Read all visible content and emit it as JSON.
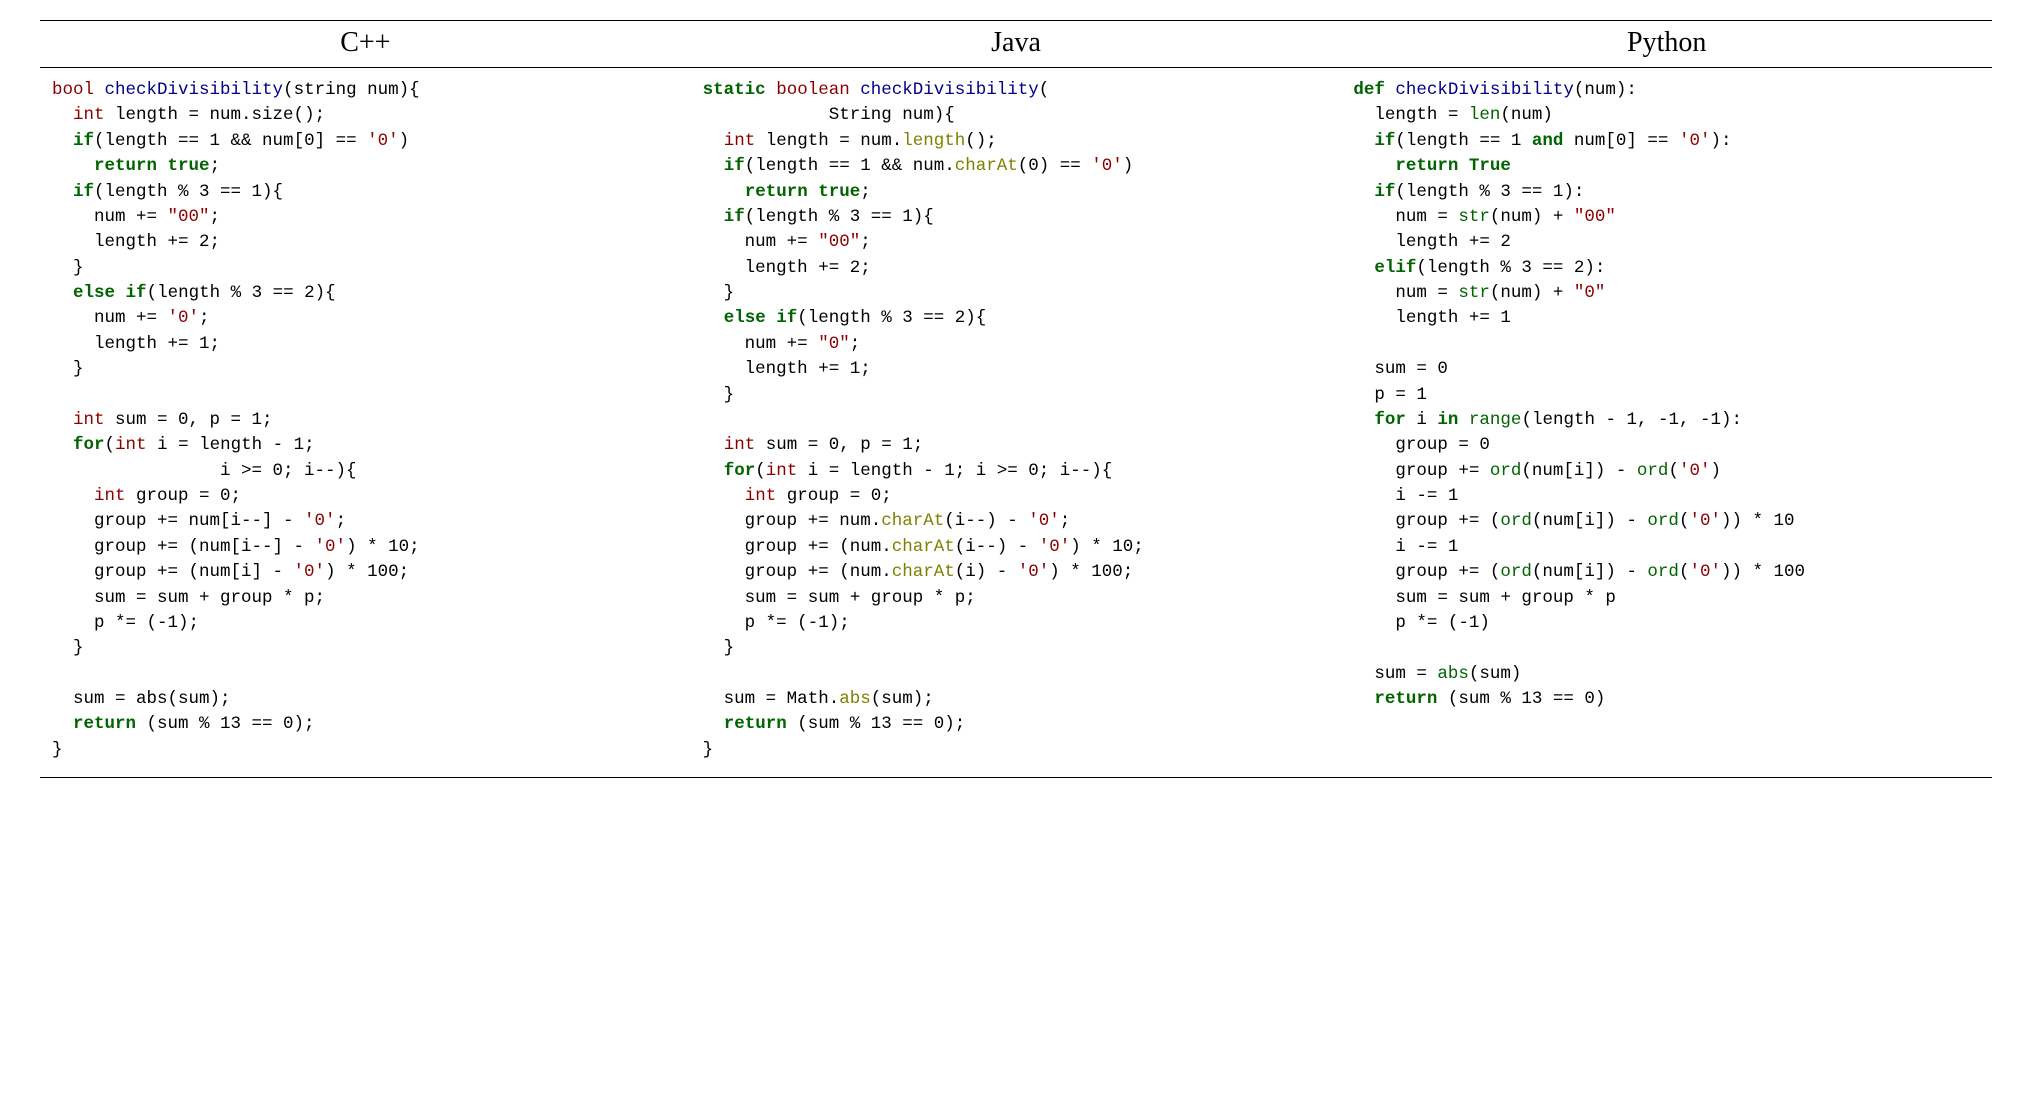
{
  "headers": {
    "cpp": "C++",
    "java": "Java",
    "python": "Python"
  },
  "cpp": {
    "l1a": "bool",
    "l1b": "checkDivisibility",
    "l1c": "(string num){",
    "l2a": "int",
    "l2b": " length = num.size();",
    "l3a": "if",
    "l3b": "(length == 1 && num[0] == ",
    "l3c": "'0'",
    "l3d": ")",
    "l4a": "return",
    "l4b": "true",
    "l4c": ";",
    "l5a": "if",
    "l5b": "(length % 3 == 1){",
    "l6a": "    num += ",
    "l6b": "\"00\"",
    "l6c": ";",
    "l7": "    length += 2;",
    "l8": "  }",
    "l9a": "else",
    "l9b": "if",
    "l9c": "(length % 3 == 2){",
    "l10a": "    num += ",
    "l10b": "'0'",
    "l10c": ";",
    "l11": "    length += 1;",
    "l12": "  }",
    "l13": "",
    "l14a": "int",
    "l14b": " sum = 0, p = 1;",
    "l15a": "for",
    "l15b": "(",
    "l15c": "int",
    "l15d": " i = length - 1;",
    "l16": "                i >= 0; i--){",
    "l17a": "int",
    "l17b": " group = 0;",
    "l18a": "    group += num[i--] - ",
    "l18b": "'0'",
    "l18c": ";",
    "l19a": "    group += (num[i--] - ",
    "l19b": "'0'",
    "l19c": ") * 10;",
    "l20a": "    group += (num[i] - ",
    "l20b": "'0'",
    "l20c": ") * 100;",
    "l21": "    sum = sum + group * p;",
    "l22": "    p *= (-1);",
    "l23": "  }",
    "l24": "",
    "l25": "  sum = abs(sum);",
    "l26a": "return",
    "l26b": " (sum % 13 == 0);",
    "l27": "}"
  },
  "java": {
    "l1a": "static",
    "l1b": "boolean",
    "l1c": "checkDivisibility",
    "l1d": "(",
    "l2": "            String num){",
    "l3a": "int",
    "l3b": " length = num.",
    "l3c": "length",
    "l3d": "();",
    "l4a": "if",
    "l4b": "(length == 1 && num.",
    "l4c": "charAt",
    "l4d": "(0) == ",
    "l4e": "'0'",
    "l4f": ")",
    "l5a": "return",
    "l5b": "true",
    "l5c": ";",
    "l6a": "if",
    "l6b": "(length % 3 == 1){",
    "l7a": "    num += ",
    "l7b": "\"00\"",
    "l7c": ";",
    "l8": "    length += 2;",
    "l9": "  }",
    "l10a": "else",
    "l10b": "if",
    "l10c": "(length % 3 == 2){",
    "l11a": "    num += ",
    "l11b": "\"0\"",
    "l11c": ";",
    "l12": "    length += 1;",
    "l13": "  }",
    "l14": "",
    "l15a": "int",
    "l15b": " sum = 0, p = 1;",
    "l16a": "for",
    "l16b": "(",
    "l16c": "int",
    "l16d": " i = length - 1; i >= 0; i--){",
    "l17a": "int",
    "l17b": " group = 0;",
    "l18a": "    group += num.",
    "l18b": "charAt",
    "l18c": "(i--) - ",
    "l18d": "'0'",
    "l18e": ";",
    "l19a": "    group += (num.",
    "l19b": "charAt",
    "l19c": "(i--) - ",
    "l19d": "'0'",
    "l19e": ") * 10;",
    "l20a": "    group += (num.",
    "l20b": "charAt",
    "l20c": "(i) - ",
    "l20d": "'0'",
    "l20e": ") * 100;",
    "l21": "    sum = sum + group * p;",
    "l22": "    p *= (-1);",
    "l23": "  }",
    "l24": "",
    "l25a": "  sum = Math.",
    "l25b": "abs",
    "l25c": "(sum);",
    "l26a": "return",
    "l26b": " (sum % 13 == 0);",
    "l27": "}"
  },
  "python": {
    "l1a": "def",
    "l1b": "checkDivisibility",
    "l1c": "(num):",
    "l2a": "  length = ",
    "l2b": "len",
    "l2c": "(num)",
    "l3a": "if",
    "l3b": "(length == 1 ",
    "l3c": "and",
    "l3d": " num[0] == ",
    "l3e": "'0'",
    "l3f": "):",
    "l4a": "return",
    "l4b": "True",
    "l5a": "if",
    "l5b": "(length % 3 == 1):",
    "l6a": "    num = ",
    "l6b": "str",
    "l6c": "(num) + ",
    "l6d": "\"00\"",
    "l7": "    length += 2",
    "l8a": "elif",
    "l8b": "(length % 3 == 2):",
    "l9a": "    num = ",
    "l9b": "str",
    "l9c": "(num) + ",
    "l9d": "\"0\"",
    "l10": "    length += 1",
    "l11": "",
    "l12": "  sum = 0",
    "l13": "  p = 1",
    "l14a": "for",
    "l14b": " i ",
    "l14c": "in",
    "l14d": "range",
    "l14e": "(length - 1, -1, -1):",
    "l15": "    group = 0",
    "l16a": "    group += ",
    "l16b": "ord",
    "l16c": "(num[i]) - ",
    "l16d": "ord",
    "l16e": "(",
    "l16f": "'0'",
    "l16g": ")",
    "l17": "    i -= 1",
    "l18a": "    group += (",
    "l18b": "ord",
    "l18c": "(num[i]) - ",
    "l18d": "ord",
    "l18e": "(",
    "l18f": "'0'",
    "l18g": ")) * 10",
    "l19": "    i -= 1",
    "l20a": "    group += (",
    "l20b": "ord",
    "l20c": "(num[i]) - ",
    "l20d": "ord",
    "l20e": "(",
    "l20f": "'0'",
    "l20g": ")) * 100",
    "l21": "    sum = sum + group * p",
    "l22": "    p *= (-1)",
    "l23": "",
    "l24a": "  sum = ",
    "l24b": "abs",
    "l24c": "(sum)",
    "l25a": "return",
    "l25b": " (sum % 13 == 0)"
  }
}
